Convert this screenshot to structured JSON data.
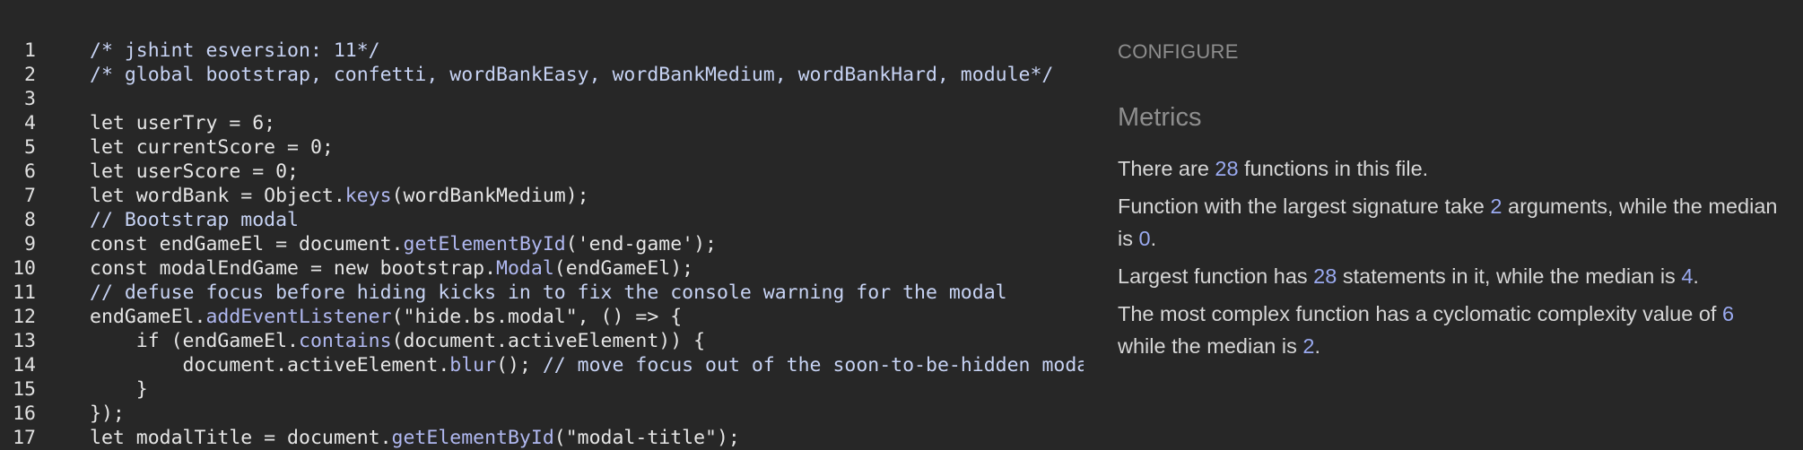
{
  "editor": {
    "lines": [
      {
        "n": "1",
        "tokens": [
          {
            "t": "/* jshint esversion: 11*/",
            "k": "comment"
          }
        ]
      },
      {
        "n": "2",
        "tokens": [
          {
            "t": "/* global bootstrap, confetti, wordBankEasy, wordBankMedium, wordBankHard, module*/",
            "k": "comment"
          }
        ]
      },
      {
        "n": "3",
        "tokens": []
      },
      {
        "n": "4",
        "tokens": [
          {
            "t": "let userTry = 6;",
            "k": "plain"
          }
        ]
      },
      {
        "n": "5",
        "tokens": [
          {
            "t": "let currentScore = 0;",
            "k": "plain"
          }
        ]
      },
      {
        "n": "6",
        "tokens": [
          {
            "t": "let userScore = 0;",
            "k": "plain"
          }
        ]
      },
      {
        "n": "7",
        "tokens": [
          {
            "t": "let wordBank = Object.",
            "k": "plain"
          },
          {
            "t": "keys",
            "k": "fn"
          },
          {
            "t": "(wordBankMedium);",
            "k": "plain"
          }
        ]
      },
      {
        "n": "8",
        "tokens": [
          {
            "t": "// Bootstrap modal",
            "k": "comment"
          }
        ]
      },
      {
        "n": "9",
        "tokens": [
          {
            "t": "const endGameEl = document.",
            "k": "plain"
          },
          {
            "t": "getElementById",
            "k": "fn"
          },
          {
            "t": "('end-game');",
            "k": "plain"
          }
        ]
      },
      {
        "n": "10",
        "tokens": [
          {
            "t": "const modalEndGame = new bootstrap.",
            "k": "plain"
          },
          {
            "t": "Modal",
            "k": "fn"
          },
          {
            "t": "(endGameEl);",
            "k": "plain"
          }
        ]
      },
      {
        "n": "11",
        "tokens": [
          {
            "t": "// defuse focus before hiding kicks in to fix the console warning for the modal",
            "k": "comment"
          }
        ]
      },
      {
        "n": "12",
        "tokens": [
          {
            "t": "endGameEl.",
            "k": "plain"
          },
          {
            "t": "addEventListener",
            "k": "fn"
          },
          {
            "t": "(\"hide.bs.modal\", () => {",
            "k": "plain"
          }
        ]
      },
      {
        "n": "13",
        "tokens": [
          {
            "t": "    if (endGameEl.",
            "k": "plain"
          },
          {
            "t": "contains",
            "k": "fn"
          },
          {
            "t": "(document.activeElement)) {",
            "k": "plain"
          }
        ]
      },
      {
        "n": "14",
        "tokens": [
          {
            "t": "        document.activeElement.",
            "k": "plain"
          },
          {
            "t": "blur",
            "k": "fn"
          },
          {
            "t": "(); ",
            "k": "plain"
          },
          {
            "t": "// move focus out of the soon-to-be-hidden modal",
            "k": "comment"
          }
        ]
      },
      {
        "n": "15",
        "tokens": [
          {
            "t": "    }",
            "k": "plain"
          }
        ]
      },
      {
        "n": "16",
        "tokens": [
          {
            "t": "});",
            "k": "plain"
          }
        ]
      },
      {
        "n": "17",
        "tokens": [
          {
            "t": "let modalTitle = document.",
            "k": "plain"
          },
          {
            "t": "getElementById",
            "k": "fn"
          },
          {
            "t": "(\"modal-title\");",
            "k": "plain"
          }
        ]
      }
    ]
  },
  "panel": {
    "configure_label": "CONFIGURE",
    "heading": "Metrics",
    "m1": {
      "a": "There are ",
      "n1": "28",
      "b": " functions in this file."
    },
    "m2": {
      "a": "Function with the largest signature take ",
      "n1": "2",
      "b": " arguments, while the median is ",
      "n2": "0",
      "c": "."
    },
    "m3": {
      "a": "Largest function has ",
      "n1": "28",
      "b": " statements in it, while the median is ",
      "n2": "4",
      "c": "."
    },
    "m4": {
      "a": "The most complex function has a cyclomatic complexity value of ",
      "n1": "6",
      "b": " while the median is ",
      "n2": "2",
      "c": "."
    }
  },
  "colors": {
    "background": "#272727",
    "code_text": "#e6e6e6",
    "comment": "#c7d3f4",
    "function_call": "#b0b8f0",
    "metric_number": "#9aaaf0",
    "muted_label": "#8e8e8e"
  }
}
